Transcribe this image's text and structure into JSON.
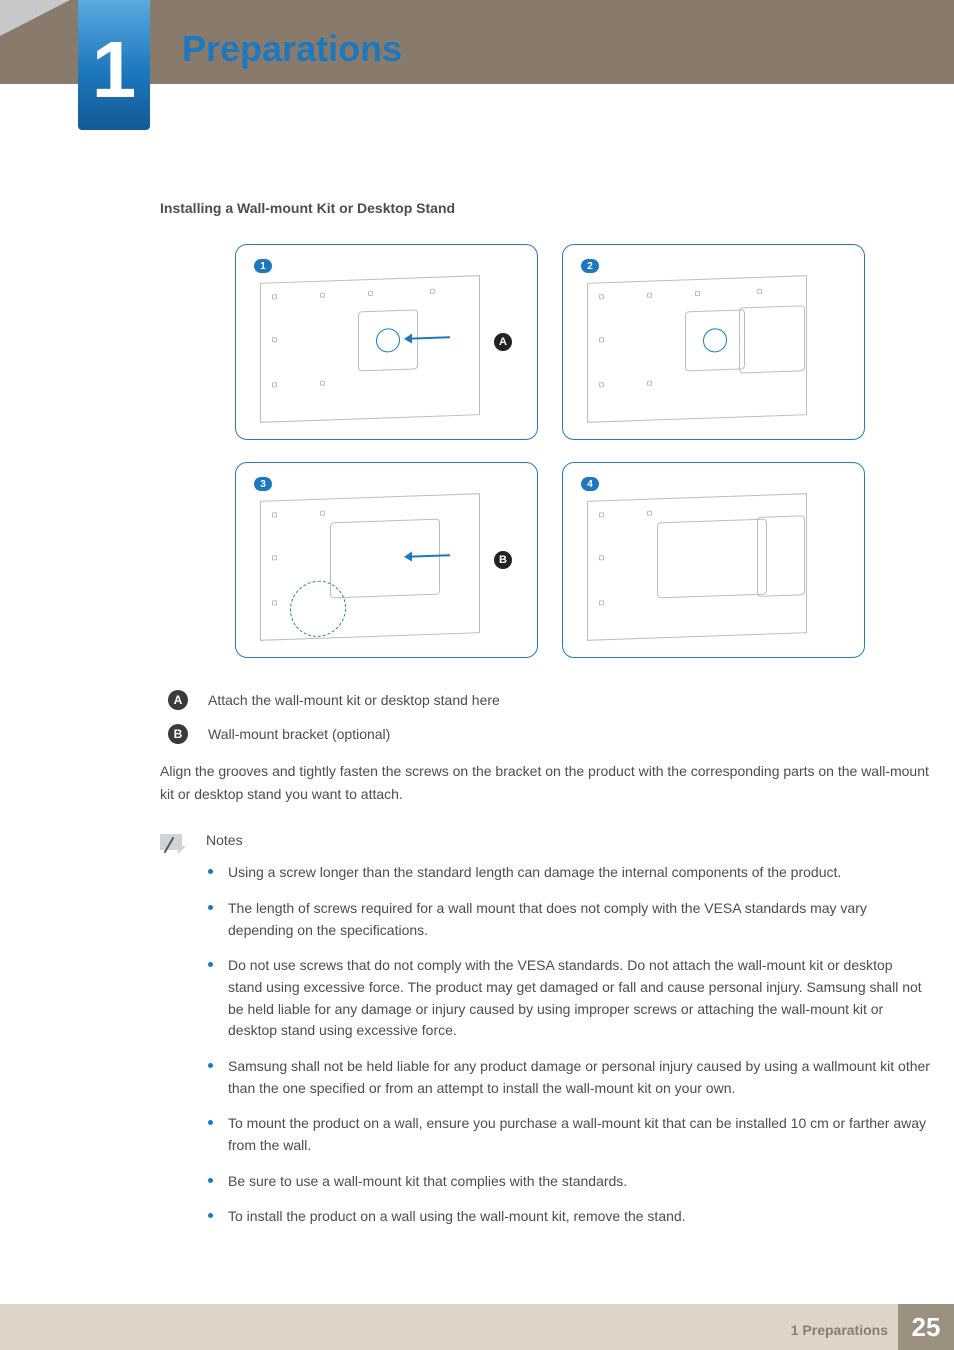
{
  "chapter": {
    "number": "1",
    "title": "Preparations"
  },
  "section_heading": "Installing a Wall-mount Kit or Desktop Stand",
  "figure": {
    "step_badges": [
      "1",
      "2",
      "3",
      "4"
    ],
    "letter_badges": [
      "A",
      "B"
    ]
  },
  "legend": [
    {
      "badge": "A",
      "text": "Attach the wall-mount kit or desktop stand here"
    },
    {
      "badge": "B",
      "text": "Wall-mount bracket (optional)"
    }
  ],
  "body_text": "Align the grooves and tightly fasten the screws on the bracket on the product with the corresponding parts on the wall-mount kit or desktop stand you want to attach.",
  "notes_heading": "Notes",
  "notes": [
    "Using a screw longer than the standard length can damage the internal components of the product.",
    "The length of screws required for a wall mount that does not comply with the VESA standards may vary depending on the specifications.",
    "Do not use screws that do not comply with the VESA standards. Do not attach the wall-mount kit or desktop stand using excessive force. The product may get damaged or fall and cause personal injury. Samsung shall not be held liable for any damage or injury caused by using improper screws or attaching the wall-mount kit or desktop stand using excessive force.",
    "Samsung shall not be held liable for any product damage or personal injury caused by using a wallmount kit other than the one specified or from an attempt to install the wall-mount kit on your own.",
    "To mount the product on a wall, ensure you purchase a wall-mount kit that can be installed 10 cm or farther away from the wall.",
    "Be sure to use a wall-mount kit that complies with the standards.",
    "To install the product on a wall using the wall-mount kit, remove the stand."
  ],
  "footer": {
    "label": "1 Preparations",
    "page": "25"
  }
}
